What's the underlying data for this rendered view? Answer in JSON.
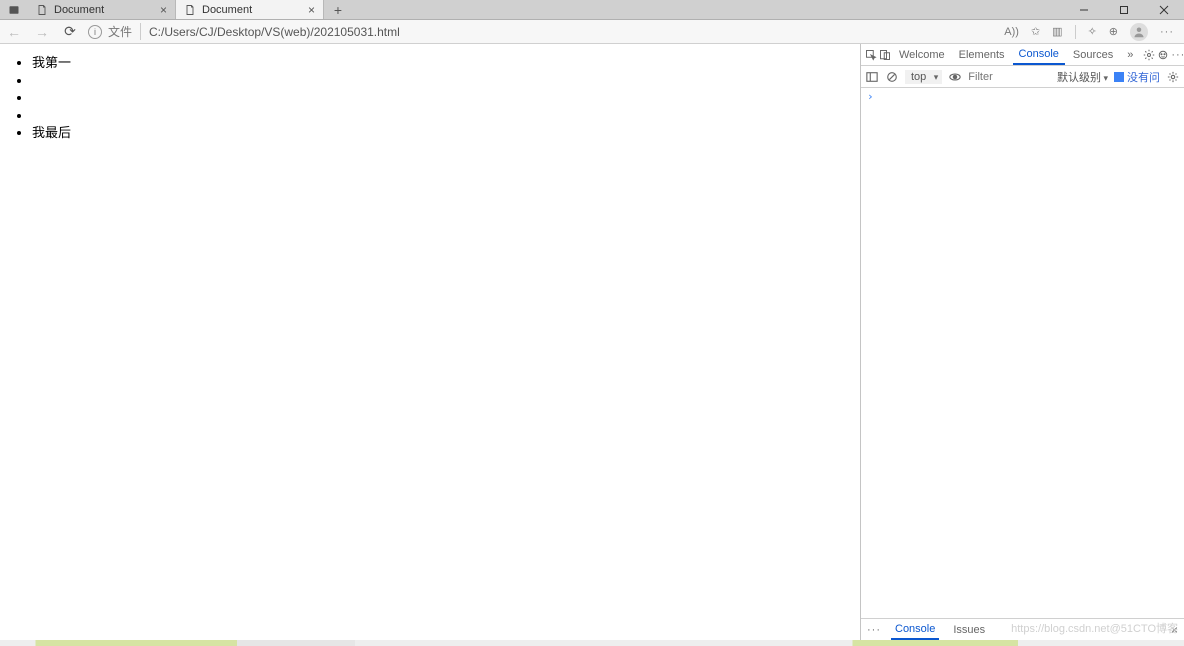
{
  "titlebar": {
    "tabs": [
      {
        "title": "Document"
      },
      {
        "title": "Document"
      }
    ]
  },
  "addressbar": {
    "file_label": "文件",
    "url": "C:/Users/CJ/Desktop/VS(web)/202105031.html",
    "read_aloud": "A))"
  },
  "page": {
    "items": [
      "我第一",
      "",
      "",
      "",
      "我最后"
    ]
  },
  "devtools": {
    "tabs": {
      "welcome": "Welcome",
      "elements": "Elements",
      "console": "Console",
      "sources": "Sources"
    },
    "toolbar": {
      "context": "top",
      "filter_placeholder": "Filter",
      "levels": "默认级别",
      "no_issues": "没有问"
    },
    "prompt": "›",
    "drawer": {
      "console": "Console",
      "issues": "Issues"
    }
  },
  "watermark": "https://blog.csdn.net@51CTO博客"
}
